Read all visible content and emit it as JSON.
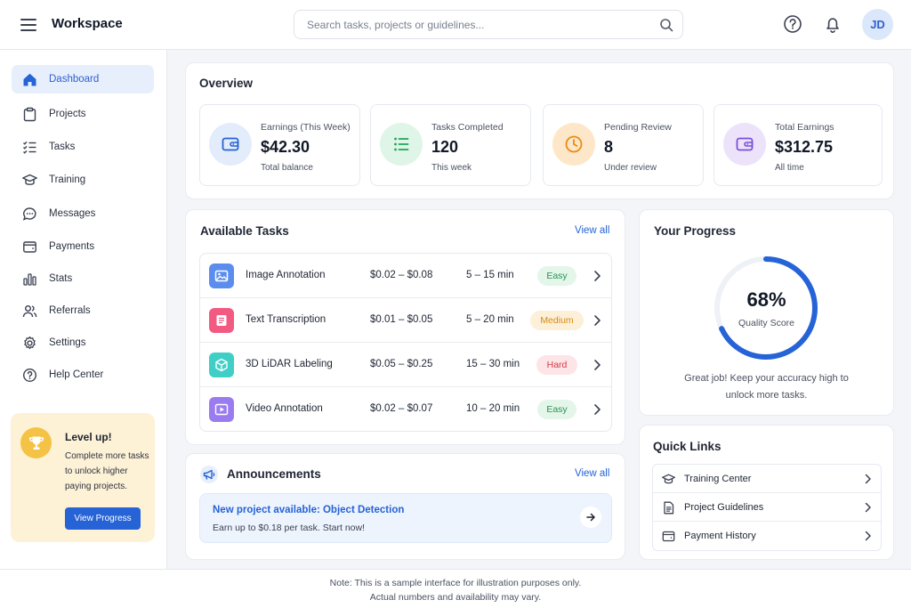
{
  "app": {
    "title": "Workspace"
  },
  "header": {
    "search_placeholder": "Search tasks, projects or guidelines...",
    "avatar_initials": "JD",
    "icons": [
      "menu-icon",
      "search-icon",
      "help-icon",
      "bell-icon"
    ]
  },
  "sidebar": {
    "items": [
      {
        "label": "Dashboard",
        "icon": "home-icon",
        "active": true
      },
      {
        "label": "Projects",
        "icon": "clipboard-icon"
      },
      {
        "label": "Tasks",
        "icon": "checklist-icon"
      },
      {
        "label": "Training",
        "icon": "graduation-cap-icon"
      },
      {
        "label": "Messages",
        "icon": "chat-icon"
      },
      {
        "label": "Payments",
        "icon": "wallet-icon"
      },
      {
        "label": "Stats",
        "icon": "bar-chart-icon"
      },
      {
        "label": "Referrals",
        "icon": "users-icon"
      },
      {
        "label": "Settings",
        "icon": "gear-icon"
      },
      {
        "label": "Help Center",
        "icon": "help-icon"
      }
    ],
    "levelup": {
      "title": "Level up!",
      "text": "Complete more tasks to unlock higher paying projects.",
      "button": "View Progress"
    }
  },
  "overview": {
    "title": "Overview",
    "stats": [
      {
        "label": "Earnings (This Week)",
        "value": "$42.30",
        "sub": "Total balance",
        "icon": "wallet-icon",
        "color": "#2563d6",
        "bg": "#e3ecfb"
      },
      {
        "label": "Tasks Completed",
        "value": "120",
        "sub": "This week",
        "icon": "list-check-icon",
        "color": "#22a35a",
        "bg": "#dff5e7"
      },
      {
        "label": "Pending Review",
        "value": "8",
        "sub": "Under review",
        "icon": "clock-icon",
        "color": "#e98b12",
        "bg": "#fde7c8"
      },
      {
        "label": "Total Earnings",
        "value": "$312.75",
        "sub": "All time",
        "icon": "wallet-icon",
        "color": "#7c4fd8",
        "bg": "#ece3fb"
      }
    ]
  },
  "tasks": {
    "title": "Available Tasks",
    "view_all": "View all",
    "rows": [
      {
        "name": "Image Annotation",
        "pay": "$0.02 – $0.08",
        "time": "5 – 15 min",
        "difficulty": "Easy",
        "icon": "image-icon",
        "icon_color": "#5b8def"
      },
      {
        "name": "Text Transcription",
        "pay": "$0.01 – $0.05",
        "time": "5 – 20 min",
        "difficulty": "Medium",
        "icon": "document-icon",
        "icon_color": "#f25a82"
      },
      {
        "name": "3D LiDAR Labeling",
        "pay": "$0.05 – $0.25",
        "time": "15 – 30 min",
        "difficulty": "Hard",
        "icon": "cube-icon",
        "icon_color": "#3fcfc7"
      },
      {
        "name": "Video Annotation",
        "pay": "$0.02 – $0.07",
        "time": "10 – 20 min",
        "difficulty": "Easy",
        "icon": "play-icon",
        "icon_color": "#9b7cf0"
      }
    ],
    "badge_colors": {
      "Easy": {
        "bg": "#e4f6ea",
        "fg": "#24934f"
      },
      "Medium": {
        "bg": "#fdf0d9",
        "fg": "#d98a10"
      },
      "Hard": {
        "bg": "#fde4e6",
        "fg": "#d63a48"
      }
    }
  },
  "announcements": {
    "title": "Announcements",
    "view_all": "View all",
    "item": {
      "title": "New project available: Object Detection",
      "text": "Earn up to $0.18 per task. Start now!"
    }
  },
  "progress": {
    "title": "Your Progress",
    "value_text": "68%",
    "fraction": 0.68,
    "label": "Quality Score",
    "message": "Great job! Keep your accuracy high to unlock more tasks."
  },
  "quick_links": {
    "title": "Quick Links",
    "items": [
      {
        "label": "Training Center",
        "icon": "graduation-cap-icon"
      },
      {
        "label": "Project Guidelines",
        "icon": "document-icon"
      },
      {
        "label": "Payment History",
        "icon": "wallet-icon"
      }
    ]
  },
  "footer": {
    "line1": "Note: This is a sample interface for illustration purposes only.",
    "line2": "Actual numbers and availability may vary."
  }
}
